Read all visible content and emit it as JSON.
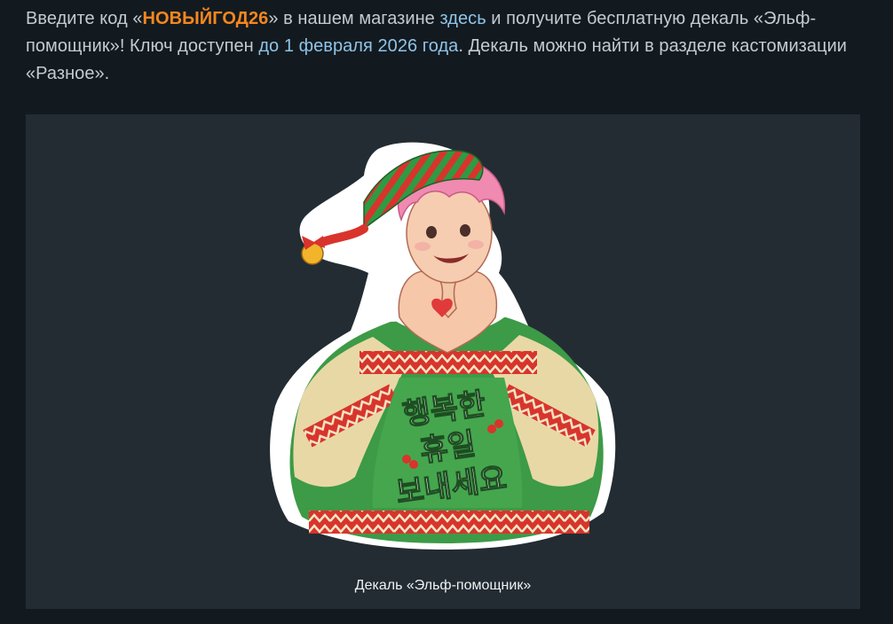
{
  "article": {
    "intro": {
      "part1": "Введите код «",
      "promo_code": "НОВЫЙГОД26",
      "part2": "» в нашем магазине ",
      "store_link": "здесь",
      "part3": " и получите бесплатную декаль «Эльф-помощник»! Ключ доступен ",
      "date_link": "до 1 февраля 2026 года",
      "part4": ". Декаль можно найти в разделе кастомизации «Разное»."
    },
    "media": {
      "image_alt": "",
      "sweater_text": [
        "행복한",
        "휴일",
        "보내세요"
      ],
      "caption": "Декаль «Эльф-помощник»"
    }
  },
  "colors": {
    "background": "#131a1f",
    "panel": "#232c33",
    "promo_code": "#f5871f",
    "link": "#8fc4e8",
    "text": "#c2cbd1",
    "caption": "#eef2f4"
  }
}
